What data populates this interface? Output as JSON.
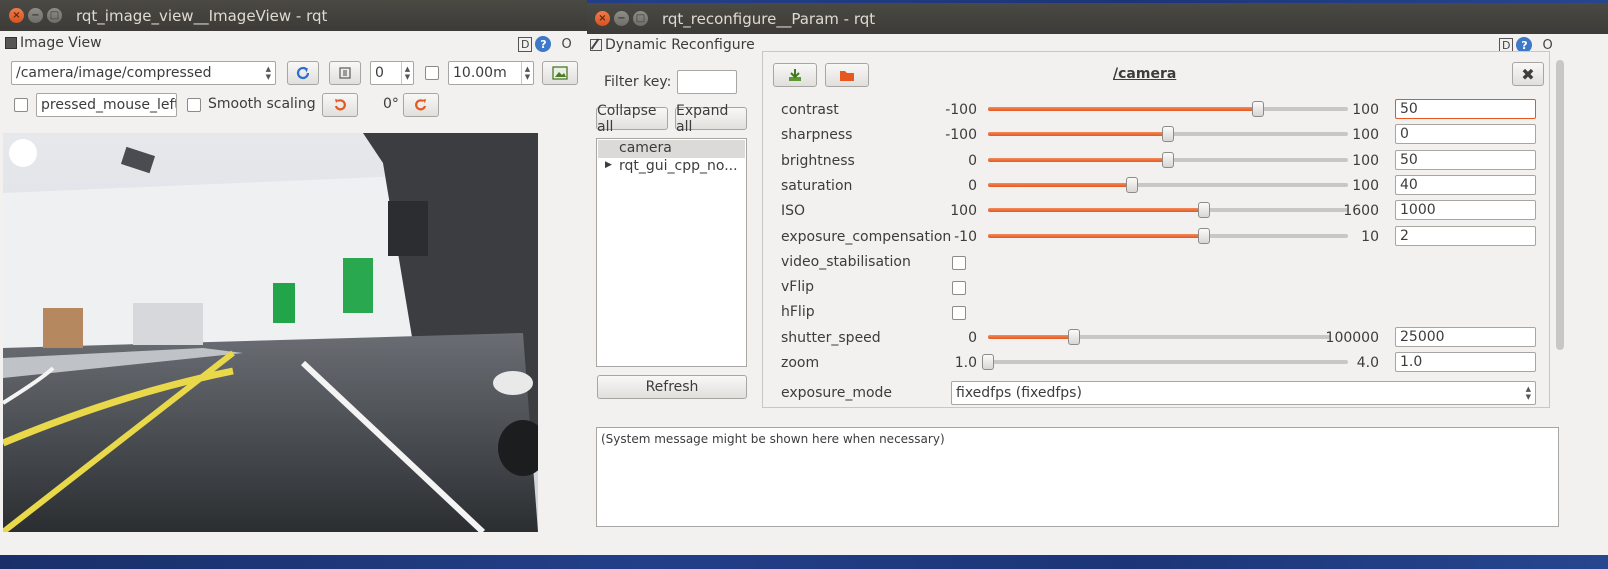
{
  "image_view": {
    "window_title": "rqt_image_view__ImageView - rqt",
    "dock_title": "Image View",
    "dock_badge": "D",
    "dock_help": "?",
    "dock_close": "O",
    "topic": "/camera/image/compressed",
    "refresh_icon": "refresh-icon",
    "spin_value": "0",
    "max_range": "10.00m",
    "mouse_topic": "pressed_mouse_left",
    "smooth_scaling_label": "Smooth scaling",
    "rotation": "0°"
  },
  "reconfigure": {
    "window_title": "rqt_reconfigure__Param - rqt",
    "dock_title": "Dynamic Reconfigure",
    "dock_badge": "D",
    "dock_help": "?",
    "dock_close": "O",
    "filter_label": "Filter key:",
    "filter_value": "",
    "collapse_label": "Collapse all",
    "expand_label": "Expand all",
    "tree": [
      {
        "label": "camera",
        "selected": true
      },
      {
        "label": "rqt_gui_cpp_no...",
        "expandable": true
      }
    ],
    "refresh_label": "Refresh",
    "node_title": "/camera",
    "params": [
      {
        "name": "contrast",
        "min": "-100",
        "max": "100",
        "value": "50",
        "fraction": 0.75
      },
      {
        "name": "sharpness",
        "min": "-100",
        "max": "100",
        "value": "0",
        "fraction": 0.5
      },
      {
        "name": "brightness",
        "min": "0",
        "max": "100",
        "value": "50",
        "fraction": 0.5
      },
      {
        "name": "saturation",
        "min": "0",
        "max": "100",
        "value": "40",
        "fraction": 0.4
      },
      {
        "name": "ISO",
        "min": "100",
        "max": "1600",
        "value": "1000",
        "fraction": 0.6
      },
      {
        "name": "exposure_compensation",
        "min": "-10",
        "max": "10",
        "value": "2",
        "fraction": 0.6
      },
      {
        "name": "video_stabilisation",
        "bool": true
      },
      {
        "name": "vFlip",
        "bool": true
      },
      {
        "name": "hFlip",
        "bool": true
      },
      {
        "name": "shutter_speed",
        "min": "0",
        "max": "100000",
        "value": "25000",
        "fraction": 0.25
      },
      {
        "name": "zoom",
        "min": "1.0",
        "max": "4.0",
        "value": "1.0",
        "fraction": 0.0
      }
    ],
    "exposure_mode_label": "exposure_mode",
    "exposure_mode_value": "fixedfps (fixedfps)",
    "system_message": "(System message might be shown here when necessary)"
  },
  "colors": {
    "slider_fill": "#e5581f",
    "titlebar": "#3c3b37",
    "close_button": "#d9531e"
  }
}
